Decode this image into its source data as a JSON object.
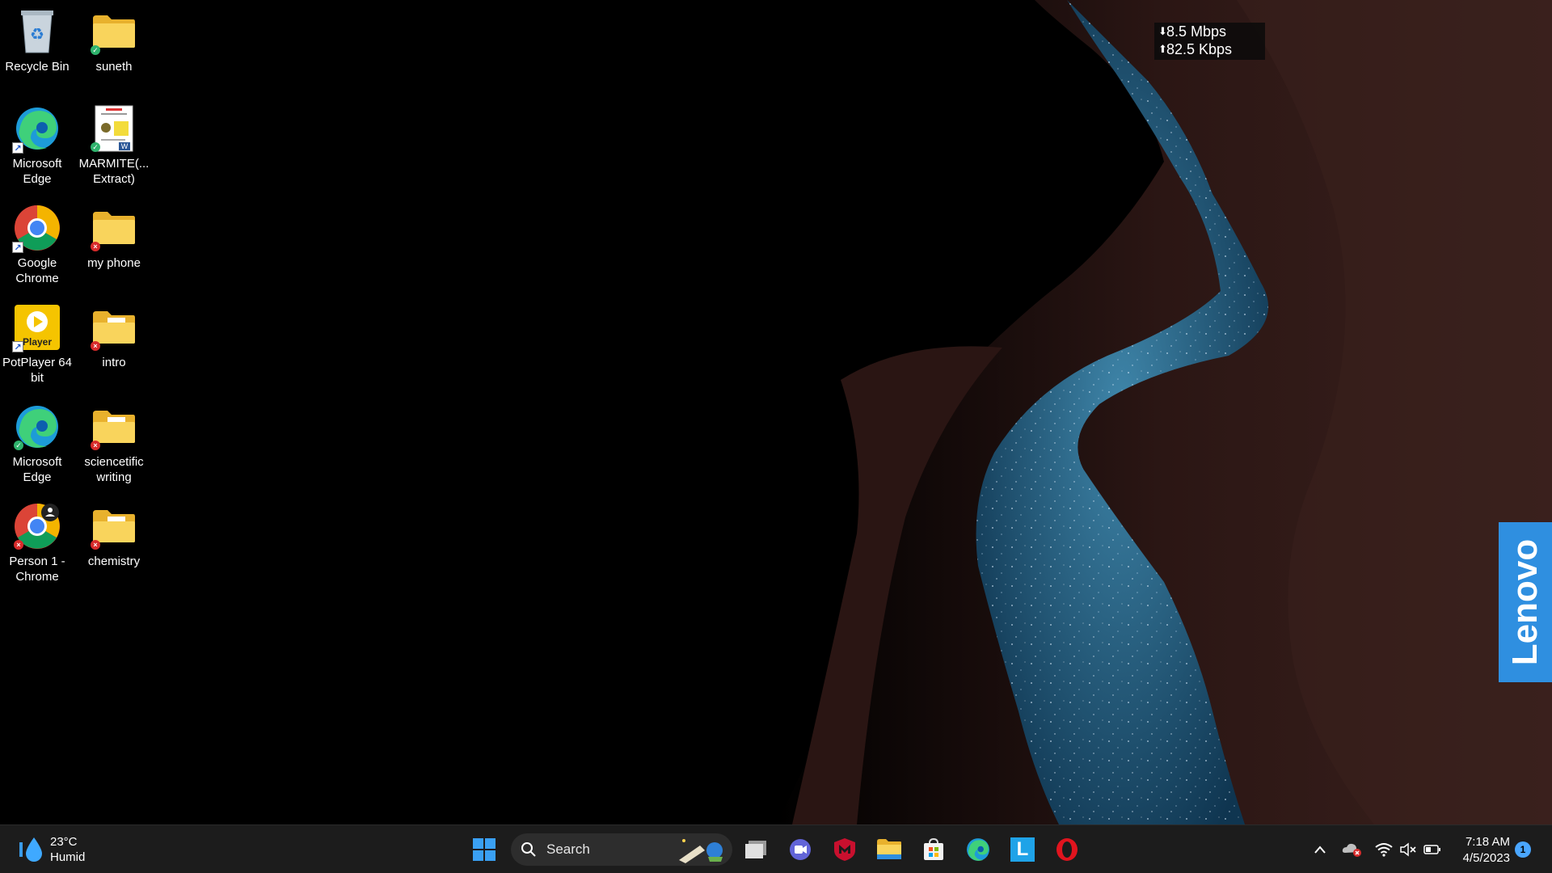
{
  "desktop": {
    "icons": [
      {
        "label": "Recycle Bin",
        "icon": "recycle-bin-icon"
      },
      {
        "label": "suneth",
        "icon": "folder-icon",
        "status": "synced"
      },
      {
        "label": "Microsoft\nEdge",
        "icon": "edge-icon",
        "shortcut": true
      },
      {
        "label": "MARMITE(...\nExtract)",
        "icon": "word-document-icon",
        "status": "synced"
      },
      {
        "label": "Google\nChrome",
        "icon": "chrome-icon",
        "shortcut": true
      },
      {
        "label": "my phone",
        "icon": "folder-icon",
        "status": "error"
      },
      {
        "label": "PotPlayer 64\nbit",
        "icon": "potplayer-icon",
        "shortcut": true,
        "icon_text": "Player"
      },
      {
        "label": "intro",
        "icon": "folder-icon",
        "status": "error"
      },
      {
        "label": "Microsoft\nEdge",
        "icon": "edge-icon",
        "status": "synced"
      },
      {
        "label": "sciencetific\nwriting",
        "icon": "folder-icon",
        "status": "error"
      },
      {
        "label": "Person 1 -\nChrome",
        "icon": "chrome-profile-icon",
        "status": "error"
      },
      {
        "label": "chemistry",
        "icon": "folder-icon",
        "status": "error"
      }
    ]
  },
  "netspeed": {
    "download": "8.5 Mbps",
    "upload": "82.5 Kbps"
  },
  "brand": {
    "text": "Lenovo",
    "color": "#2f8fe0"
  },
  "taskbar": {
    "weather": {
      "temp": "23°C",
      "condition": "Humid",
      "icon": "water-drop-icon"
    },
    "search": {
      "label": "Search"
    },
    "apps": [
      {
        "name": "start-button",
        "icon": "windows-logo-icon"
      },
      {
        "name": "task-view-button",
        "icon": "task-view-icon"
      },
      {
        "name": "teams-chat-button",
        "icon": "teams-chat-icon"
      },
      {
        "name": "mcafee-button",
        "icon": "mcafee-shield-icon"
      },
      {
        "name": "file-explorer-button",
        "icon": "folder-icon"
      },
      {
        "name": "microsoft-store-button",
        "icon": "store-icon"
      },
      {
        "name": "edge-taskbar-button",
        "icon": "edge-icon"
      },
      {
        "name": "lenovo-vantage-button",
        "icon": "lenovo-l-icon",
        "text": "L"
      },
      {
        "name": "opera-button",
        "icon": "opera-icon"
      }
    ],
    "tray": {
      "overflow": "chevron-up-icon",
      "onedrive": "onedrive-error-icon",
      "wifi": "wifi-icon",
      "volume": "volume-muted-icon",
      "battery": "battery-icon"
    },
    "clock": {
      "time": "7:18 AM",
      "date": "4/5/2023"
    },
    "notifications": {
      "count": "1"
    }
  },
  "colors": {
    "taskbar_bg": "#1c1c1c",
    "folder": "#f5c842",
    "accent": "#4aa6ff"
  }
}
